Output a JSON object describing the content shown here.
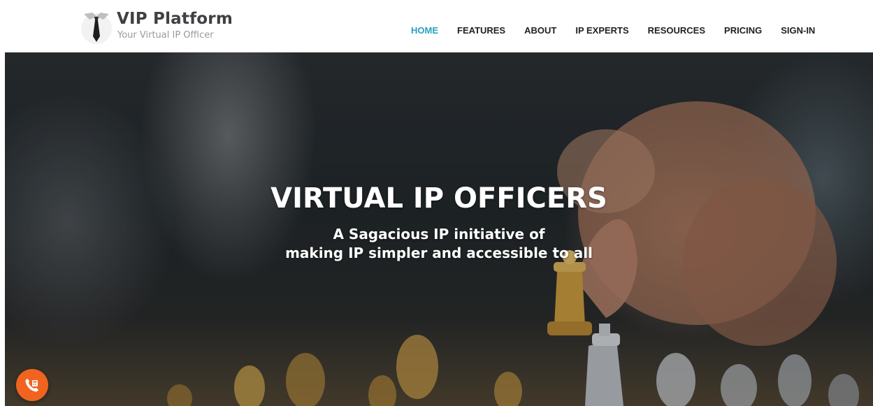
{
  "logo": {
    "title": "VIP Platform",
    "subtitle": "Your Virtual IP Officer",
    "icon": "necktie-icon"
  },
  "nav": {
    "items": [
      {
        "label": "HOME",
        "active": true
      },
      {
        "label": "FEATURES",
        "active": false
      },
      {
        "label": "ABOUT",
        "active": false
      },
      {
        "label": "IP EXPERTS",
        "active": false
      },
      {
        "label": "RESOURCES",
        "active": false
      },
      {
        "label": "PRICING",
        "active": false
      },
      {
        "label": "SIGN-IN",
        "active": false
      }
    ]
  },
  "hero": {
    "title": "VIRTUAL IP OFFICERS",
    "subtitle_line1": "A Sagacious IP initiative of",
    "subtitle_line2": "making IP simpler and accessible to all",
    "background": "chess-hand-photo"
  },
  "call_button": {
    "icon": "phone-icon"
  },
  "colors": {
    "accent": "#2aa1c0",
    "nav_text": "#222222",
    "call_button": "#f06420",
    "logo_title": "#3f4044",
    "logo_subtitle": "#9a9a9a"
  }
}
